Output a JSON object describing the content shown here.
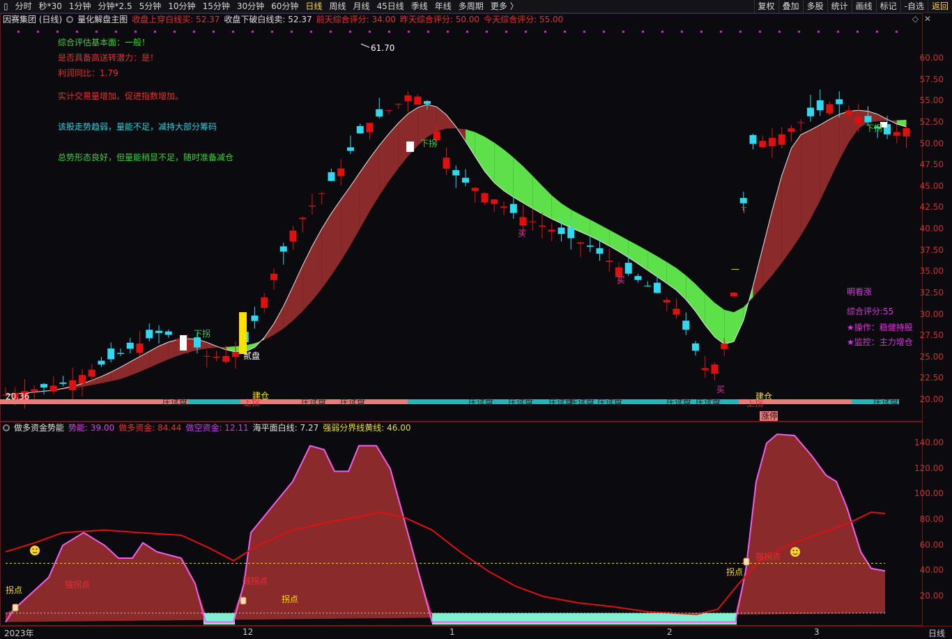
{
  "toolbar": {
    "left": [
      "分时",
      "秒*30",
      "1分钟",
      "分钟*2.5",
      "5分钟",
      "10分钟",
      "15分钟",
      "30分钟",
      "60分钟",
      "日线",
      "周线",
      "月线",
      "45日线",
      "季线",
      "年线",
      "多周期",
      "更多 〉"
    ],
    "active": "日线",
    "right": [
      "复权",
      "叠加",
      "多股",
      "统计",
      "画线",
      "标记",
      "-自选",
      "返回"
    ]
  },
  "main_header": {
    "stock": "因赛集团 (日线)",
    "indicator": "量化解盘主图",
    "items": [
      {
        "text": "收盘上穿白线买: 52.37",
        "color": "#e83030"
      },
      {
        "text": "收盘下破白线卖: 52.37",
        "color": "#e0e0e0"
      },
      {
        "text": "前天综合评分: 34.00",
        "color": "#e83030"
      },
      {
        "text": "昨天综合评分: 50.00",
        "color": "#e83030"
      },
      {
        "text": "今天综合评分: 55.00",
        "color": "#e83030"
      }
    ]
  },
  "left_notes": [
    {
      "text": "综合评估基本面：一般！",
      "color": "#3cd03c"
    },
    {
      "text": "是否具备高送转潜力：是！",
      "color": "#e83030"
    },
    {
      "text": "利润同比：1.79",
      "color": "#e83030"
    },
    {
      "text": "实计交易量增加。促进指数增加。",
      "color": "#e83030"
    },
    {
      "text": "该股走势趋弱，量能不足，减持大部分筹码",
      "color": "#2fd0e0"
    },
    {
      "text": "总势形态良好，但量能稍显不足，随时准备减仓",
      "color": "#3cd03c"
    }
  ],
  "right_notes": [
    {
      "text": "明看涨",
      "color": "#e030e0"
    },
    {
      "text": "综合评分:55",
      "color": "#e030e0"
    },
    {
      "text": "★操作：稳健持股",
      "color": "#e030e0"
    },
    {
      "text": "★监控：主力增仓",
      "color": "#e030e0"
    }
  ],
  "price_axis": [
    "60.00",
    "57.50",
    "55.00",
    "52.50",
    "50.00",
    "47.50",
    "45.00",
    "42.50",
    "40.00",
    "37.50",
    "35.00",
    "32.50",
    "30.00",
    "27.50",
    "25.00",
    "22.50",
    "20.00"
  ],
  "price_labels": {
    "high": "61.70",
    "low": "20.36"
  },
  "chart_markers": {
    "xiaguai": "下拐",
    "shangguai": "上拐",
    "erpan": "贰盘",
    "jiancang": "建仓",
    "zhuangshipan": "庄试盘",
    "mai": "买",
    "zhangting": "涨停",
    "t_marker": "T",
    "dash_marker": "—"
  },
  "sub_header": {
    "title": "做多资金势能",
    "items": [
      {
        "text": "势能: 39.00",
        "color": "#e040e0"
      },
      {
        "text": "做多资金: 84.44",
        "color": "#e83030"
      },
      {
        "text": "做空资金: 12.11",
        "color": "#c040e0"
      },
      {
        "text": "海平面白线: 7.27",
        "color": "#e0e0e0"
      },
      {
        "text": "强弱分界线黄线: 46.00",
        "color": "#e8e030"
      }
    ]
  },
  "sub_axis": [
    "140.00",
    "120.00",
    "100.00",
    "80.00",
    "60.00",
    "40.00",
    "20.00"
  ],
  "sub_labels": {
    "guaidian": "拐点",
    "xiguaidian": "强拐点"
  },
  "date_axis": {
    "start": "2023年",
    "ticks": [
      "12",
      "1",
      "2",
      "3"
    ],
    "period": "日线"
  },
  "chart_data": {
    "type": "candlestick",
    "ylim": [
      19,
      63
    ],
    "sub_ylim": [
      0,
      150
    ]
  }
}
